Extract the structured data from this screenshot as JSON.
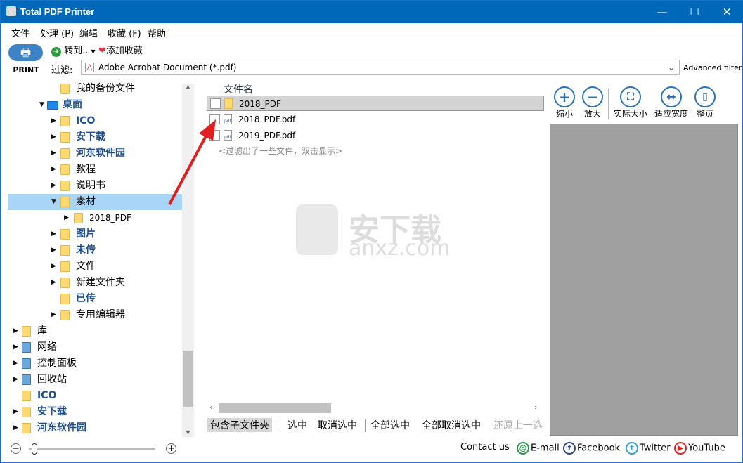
{
  "window": {
    "title": "Total PDF Printer",
    "minimize": "—",
    "maximize": "☐",
    "close": "✕"
  },
  "menu": [
    "文件",
    "处理 (P)",
    "编辑",
    "收藏 (F)",
    "帮助"
  ],
  "toolbar": {
    "print": "PRINT",
    "goto": "转到..",
    "add_favorite": "添加收藏",
    "filter_label": "过滤:",
    "filter_value": "Adobe Acrobat Document (*.pdf)",
    "advanced_filter": "Advanced filter"
  },
  "tree": [
    {
      "label": "我的备份文件",
      "level": 2,
      "bold": false,
      "arrow": ""
    },
    {
      "label": "桌面",
      "level": 1,
      "bold": true,
      "arrow": "▼",
      "icon": "desktop"
    },
    {
      "label": "ICO",
      "level": 2,
      "bold": true,
      "arrow": "▶"
    },
    {
      "label": "安下载",
      "level": 2,
      "bold": true,
      "arrow": "▶"
    },
    {
      "label": "河东软件园",
      "level": 2,
      "bold": true,
      "arrow": "▶"
    },
    {
      "label": "教程",
      "level": 2,
      "bold": false,
      "arrow": "▶"
    },
    {
      "label": "说明书",
      "level": 2,
      "bold": false,
      "arrow": "▶"
    },
    {
      "label": "素材",
      "level": 2,
      "bold": false,
      "arrow": "▼",
      "selected": true
    },
    {
      "label": "2018_PDF",
      "level": 3,
      "bold": false,
      "arrow": "▶"
    },
    {
      "label": "图片",
      "level": 2,
      "bold": true,
      "arrow": "▶"
    },
    {
      "label": "未传",
      "level": 2,
      "bold": true,
      "arrow": "▶"
    },
    {
      "label": "文件",
      "level": 2,
      "bold": false,
      "arrow": "▶"
    },
    {
      "label": "新建文件夹",
      "level": 2,
      "bold": false,
      "arrow": "▶"
    },
    {
      "label": "已传",
      "level": 2,
      "bold": true,
      "arrow": ""
    },
    {
      "label": "专用编辑器",
      "level": 2,
      "bold": false,
      "arrow": "▶"
    },
    {
      "label": "库",
      "level": 0,
      "bold": false,
      "arrow": "▶",
      "icon": "library"
    },
    {
      "label": "网络",
      "level": 0,
      "bold": false,
      "arrow": "▶",
      "icon": "network"
    },
    {
      "label": "控制面板",
      "level": 0,
      "bold": false,
      "arrow": "▶",
      "icon": "control-panel"
    },
    {
      "label": "回收站",
      "level": 0,
      "bold": false,
      "arrow": "▶",
      "icon": "recycle-bin"
    },
    {
      "label": "ICO",
      "level": 0,
      "bold": true,
      "arrow": ""
    },
    {
      "label": "安下载",
      "level": 0,
      "bold": true,
      "arrow": "▶"
    },
    {
      "label": "河东软件园",
      "level": 0,
      "bold": true,
      "arrow": "▶"
    }
  ],
  "files": {
    "header": "文件名",
    "rows": [
      {
        "name": "2018_PDF",
        "type": "folder",
        "selected": true
      },
      {
        "name": "2018_PDF.pdf",
        "type": "pdf"
      },
      {
        "name": "2019_PDF.pdf",
        "type": "pdf"
      }
    ],
    "filtered_note": "<过滤出了一些文件，双击显示>"
  },
  "preview_tools": [
    "缩小",
    "放大",
    "实际大小",
    "适应宽度",
    "整页"
  ],
  "bottom_buttons": [
    "包含子文件夹",
    "选中",
    "取消选中",
    "全部选中",
    "全部取消选中",
    "还原上一选"
  ],
  "footer": {
    "contact": "Contact us",
    "email": "E-mail",
    "facebook": "Facebook",
    "twitter": "Twitter",
    "youtube": "YouTube"
  },
  "watermark": {
    "cn": "安下载",
    "en": "anxz.com"
  },
  "colors": {
    "titlebar": "#0068b8",
    "selection": "#a9d6f7",
    "preview_bg": "#a0a0a0",
    "accent": "#2a73b8"
  }
}
